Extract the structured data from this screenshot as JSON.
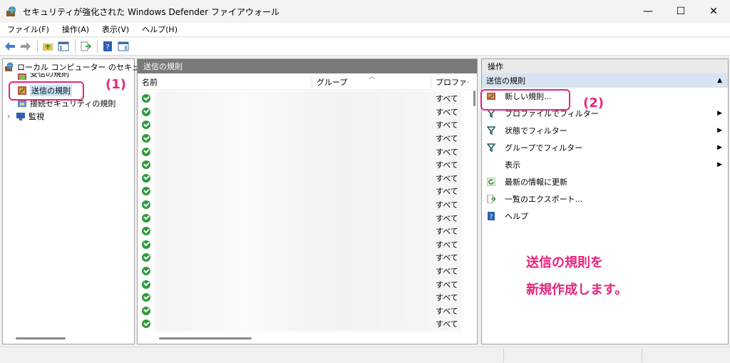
{
  "window": {
    "title": "セキュリティが強化された Windows Defender ファイアウォール",
    "minimize": "—",
    "maximize": "☐",
    "close": "✕"
  },
  "menu": [
    "ファイル(F)",
    "操作(A)",
    "表示(V)",
    "ヘルプ(H)"
  ],
  "tree": {
    "root": "ローカル コンピューター のセキュリティ",
    "items": [
      {
        "label": "受信の規則",
        "icon": "inbound-rules-icon"
      },
      {
        "label": "送信の規則",
        "icon": "outbound-rules-icon"
      },
      {
        "label": "接続セキュリティの規則",
        "icon": "connection-security-icon"
      },
      {
        "label": "監視",
        "icon": "monitor-icon"
      }
    ]
  },
  "center": {
    "title": "送信の規則",
    "columns": [
      "名前",
      "グループ",
      "プロファイ..."
    ],
    "profile_value": "すべて",
    "row_count": 18
  },
  "actions": {
    "header": "操作",
    "section": "送信の規則",
    "items": [
      {
        "label": "新しい規則...",
        "icon": "new-rule-icon",
        "submenu": false
      },
      {
        "label": "プロファイルでフィルター",
        "icon": "filter-icon",
        "submenu": true
      },
      {
        "label": "状態でフィルター",
        "icon": "filter-icon",
        "submenu": true
      },
      {
        "label": "グループでフィルター",
        "icon": "filter-icon",
        "submenu": true
      },
      {
        "label": "表示",
        "icon": "",
        "submenu": true
      },
      {
        "label": "最新の情報に更新",
        "icon": "refresh-icon",
        "submenu": false
      },
      {
        "label": "一覧のエクスポート...",
        "icon": "export-icon",
        "submenu": false
      },
      {
        "label": "ヘルプ",
        "icon": "help-icon",
        "submenu": false
      }
    ]
  },
  "annotations": {
    "step1": "(1)",
    "step2": "(2)",
    "note_line1": "送信の規則を",
    "note_line2": "新規作成します。",
    "color": "#e8247a"
  }
}
